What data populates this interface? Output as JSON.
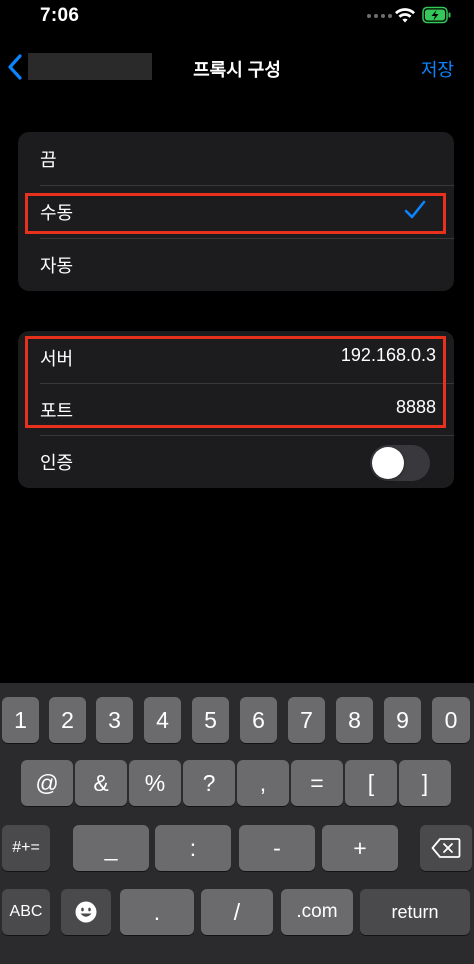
{
  "status_bar": {
    "time": "7:06",
    "wifi_icon": "wifi-icon",
    "battery_icon": "battery-charging-icon",
    "accent": "#35c759"
  },
  "nav": {
    "title": "프록시 구성",
    "save_label": "저장",
    "back_icon": "chevron-left-icon",
    "accent": "#0a84ff"
  },
  "proxy_mode": {
    "options": [
      {
        "label": "끔",
        "selected": false
      },
      {
        "label": "수동",
        "selected": true
      },
      {
        "label": "자동",
        "selected": false
      }
    ]
  },
  "proxy_settings": {
    "server": {
      "label": "서버",
      "value": "192.168.0.3"
    },
    "port": {
      "label": "포트",
      "value": "8888"
    },
    "auth": {
      "label": "인증",
      "enabled": false
    }
  },
  "highlight_color": "#e8311c",
  "keyboard": {
    "row1": [
      "1",
      "2",
      "3",
      "4",
      "5",
      "6",
      "7",
      "8",
      "9",
      "0"
    ],
    "row2": [
      "@",
      "&",
      "%",
      "?",
      ",",
      "=",
      "[",
      "]"
    ],
    "row3": {
      "shift": "#+=",
      "keys": [
        "_",
        ":",
        "-",
        "+"
      ],
      "delete_icon": "delete-left-icon"
    },
    "row4": {
      "abc": "ABC",
      "emoji_icon": "emoji-icon",
      "dot": ".",
      "slash": "/",
      "dotcom": ".com",
      "return": "return"
    }
  }
}
